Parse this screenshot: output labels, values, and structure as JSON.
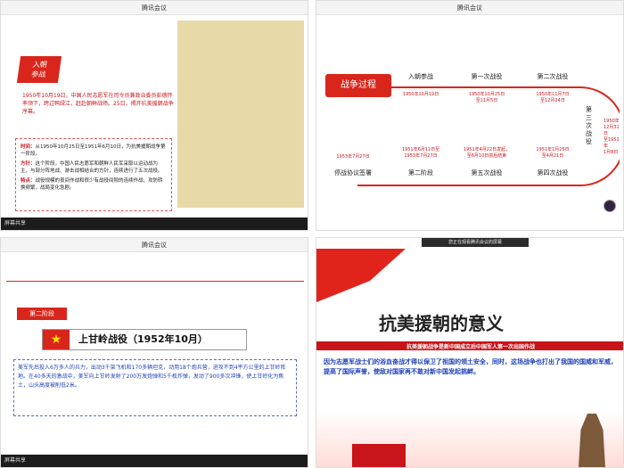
{
  "app": {
    "title": "腾讯会议",
    "share_label": "屏幕共享"
  },
  "panel1": {
    "tag": "入朝\n参战",
    "intro": "1950年10月19日，中国人民志愿军在司令员兼政治委员彭德怀率领下，跨过鸭绿江，赶赴朝鲜战场。25日，揭开抗美援朝战争序幕。",
    "rows": [
      {
        "label": "时间：",
        "text": "从1950年10月25日至1951年6月10日，为抗美援朝战争第一阶段。"
      },
      {
        "label": "方针：",
        "text": "这个阶段，中国人民志愿军和朝鲜人民军采取以运动战为主，与部分阵地战、游击战相结合的方针，连续进行了五次战役。"
      },
      {
        "label": "特点：",
        "text": "战役规模的夜间作战和很少有战役间隙的连续作战，攻防转换频繁，战局变化急剧。"
      }
    ]
  },
  "panel2": {
    "label": "战争过程",
    "top_steps": [
      "入朝参战",
      "第一次战役",
      "第二次战役"
    ],
    "top_dates": [
      "1950年10月19日",
      "1950年10月25日\n至11月5日",
      "1950年11月7日\n至12月24日"
    ],
    "third": "第三次战役",
    "third_date": "1950年\n12月31日\n至1951年\n1月8日",
    "bottom_steps": [
      "停战协议签署",
      "第二阶段",
      "第五次战役",
      "第四次战役"
    ],
    "bottom_dates": [
      "1953年7月27日",
      "1951年6月11日至\n1953年7月27日",
      "1951年4月22日发起，\n至6月10日前后结束",
      "1951年1月25日\n至4月21日"
    ]
  },
  "panel3": {
    "badge": "第二阶段",
    "heading": "上甘岭战役（1952年10月）",
    "desc": "美军先后投入6万多人的兵力，出动3千架飞机和170多辆坦克，动用18个炮兵营，进攻不到4平方公里的上甘岭阵地。在40多天的激战中，美军向上甘岭发射了200万发炮弹和5千枚炸弹，发动了900多次冲锋，使上甘岭化为焦土，山头高度被削低2米。"
  },
  "panel4": {
    "screenbar": "您正在观看腾讯会议的屏幕",
    "title": "抗美援朝的意义",
    "sub1": "抗美援朝战争是新中国成立后中国军人第一次出国作战",
    "sub2": "因为志愿军战士们的浴血奋战才得以保卫了祖国的领土安全，同时，这场战争也打出了我国的国威和军威，提高了国际声誉，使敌对国家再不敢对新中国发起挑衅。"
  }
}
